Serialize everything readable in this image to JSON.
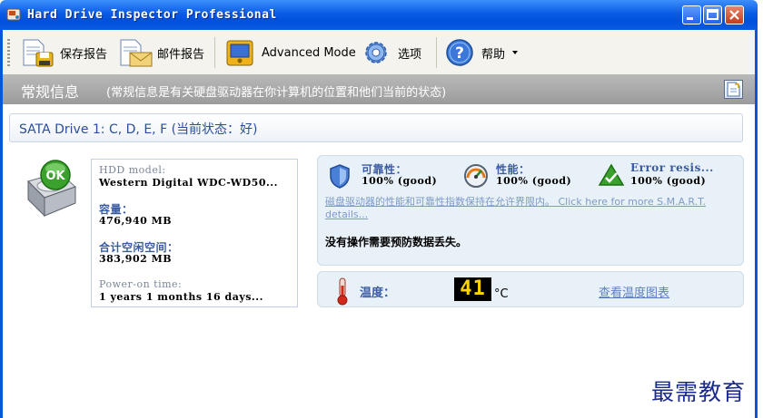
{
  "window": {
    "title": "Hard Drive Inspector Professional"
  },
  "toolbar": {
    "save_report": "保存报告",
    "mail_report": "邮件报告",
    "advanced_mode": "Advanced Mode",
    "options": "选项",
    "help": "帮助"
  },
  "banner": {
    "title": "常规信息",
    "subtitle": "(常规信息是有关硬盘驱动器在你计算机的位置和他们当前的状态)"
  },
  "drive": {
    "header": "SATA Drive 1: C, D, E, F (当前状态：好)",
    "status_badge": "OK",
    "model_label": "HDD model:",
    "model_value": "Western Digital WDC-WD50...",
    "capacity_label": "容量：",
    "capacity_value": "476,940 MB",
    "free_label": "合计空闲空间：",
    "free_value": "383,902 MB",
    "poweron_label": "Power-on time:",
    "poweron_value": "1 years 1 months 16 days..."
  },
  "stats": {
    "reliability_label": "可靠性：",
    "reliability_value": "100% (good)",
    "performance_label": "性能：",
    "performance_value": "100% (good)",
    "error_label": "Error resis...",
    "error_value": "100% (good)",
    "smart_link": "磁盘驱动器的性能和可靠性指数保持在允许界限内。 Click here for more S.M.A.R.T. details...",
    "no_action": "没有操作需要预防数据丢失。"
  },
  "temperature": {
    "label": "温度：",
    "value": "41",
    "unit": "°C",
    "chart_link": "查看温度图表"
  },
  "watermark": "最需教育",
  "colors": {
    "titlebar": "#0a5be6",
    "banner": "#a9a9a9",
    "panel": "#e9f1f8",
    "ok_green": "#3aa12d",
    "lcd_text": "#ffd400"
  }
}
